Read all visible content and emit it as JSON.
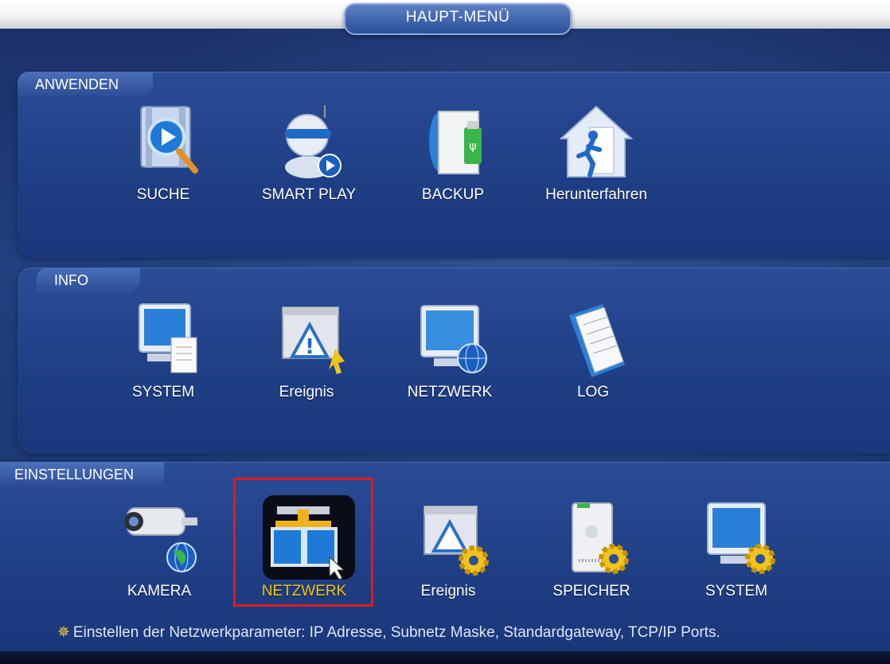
{
  "window": {
    "title": "HAUPT-MENÜ"
  },
  "sections": {
    "apply": {
      "label": "ANWENDEN",
      "items": [
        {
          "label": "SUCHE",
          "icon": "search-video-icon"
        },
        {
          "label": "SMART PLAY",
          "icon": "robot-play-icon"
        },
        {
          "label": "BACKUP",
          "icon": "disc-usb-icon"
        },
        {
          "label": "Herunterfahren",
          "icon": "exit-house-icon"
        }
      ]
    },
    "info": {
      "label": "INFO",
      "items": [
        {
          "label": "SYSTEM",
          "icon": "monitor-document-icon"
        },
        {
          "label": "Ereignis",
          "icon": "warning-window-icon"
        },
        {
          "label": "NETZWERK",
          "icon": "monitor-globe-icon"
        },
        {
          "label": "LOG",
          "icon": "notebook-icon"
        }
      ]
    },
    "settings": {
      "label": "EINSTELLUNGEN",
      "items": [
        {
          "label": "KAMERA",
          "icon": "camera-globe-icon"
        },
        {
          "label": "NETZWERK",
          "icon": "network-panels-icon",
          "selected": true
        },
        {
          "label": "Ereignis",
          "icon": "warning-gear-icon"
        },
        {
          "label": "SPEICHER",
          "icon": "storage-gear-icon"
        },
        {
          "label": "SYSTEM",
          "icon": "monitor-gear-icon"
        }
      ]
    }
  },
  "status": {
    "hint": "Einstellen der Netzwerkparameter: IP Adresse, Subnetz Maske, Standardgateway, TCP/IP Ports."
  },
  "colors": {
    "accent_selected": "#f5c400",
    "selection_border": "#e01b1b",
    "panel": "#24468d"
  }
}
